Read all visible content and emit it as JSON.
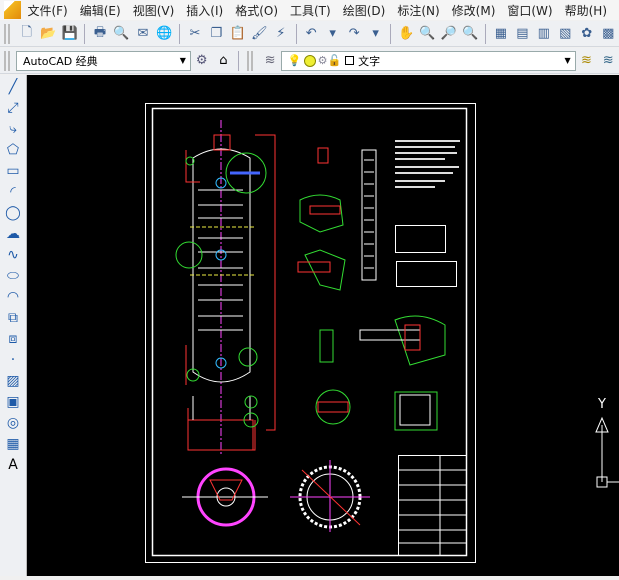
{
  "menu": [
    "文件(F)",
    "编辑(E)",
    "视图(V)",
    "插入(I)",
    "格式(O)",
    "工具(T)",
    "绘图(D)",
    "标注(N)",
    "修改(M)",
    "窗口(W)",
    "帮助(H)"
  ],
  "toolbar1": [
    {
      "icon": "new-icon",
      "g": "🗋"
    },
    {
      "icon": "open-icon",
      "g": "📂"
    },
    {
      "icon": "save-icon",
      "g": "💾"
    },
    "sep",
    {
      "icon": "print-icon",
      "g": "🖶"
    },
    {
      "icon": "print-preview-icon",
      "g": "🔍"
    },
    {
      "icon": "publish-icon",
      "g": "✉"
    },
    {
      "icon": "web-icon",
      "g": "🌐"
    },
    "sep",
    {
      "icon": "cut-icon",
      "g": "✂"
    },
    {
      "icon": "copy-icon",
      "g": "❐"
    },
    {
      "icon": "paste-icon",
      "g": "📋"
    },
    {
      "icon": "match-properties-icon",
      "g": "🖌"
    },
    {
      "icon": "block-editor-icon",
      "g": "⚡"
    },
    "sep",
    {
      "icon": "undo-icon",
      "g": "↶"
    },
    {
      "icon": "dropdown-icon",
      "g": "▾"
    },
    {
      "icon": "redo-icon",
      "g": "↷"
    },
    {
      "icon": "dropdown-icon",
      "g": "▾"
    },
    "sep",
    {
      "icon": "pan-icon",
      "g": "✋"
    },
    {
      "icon": "zoom-realtime-icon",
      "g": "🔍"
    },
    {
      "icon": "zoom-window-icon",
      "g": "🔎"
    },
    {
      "icon": "zoom-previous-icon",
      "g": "🔍"
    },
    "sep",
    {
      "icon": "properties-icon",
      "g": "▦"
    },
    {
      "icon": "design-center-icon",
      "g": "▤"
    },
    {
      "icon": "tool-palettes-icon",
      "g": "▥"
    },
    {
      "icon": "sheet-set-icon",
      "g": "▧"
    },
    {
      "icon": "markup-icon",
      "g": "✿"
    },
    {
      "icon": "calculator-icon",
      "g": "▩"
    }
  ],
  "workspace": {
    "value": "AutoCAD 经典"
  },
  "layer": {
    "value": "文字"
  },
  "left_tools": [
    {
      "icon": "line-icon",
      "g": "╱"
    },
    {
      "icon": "construction-line-icon",
      "g": "⤢"
    },
    {
      "icon": "polyline-icon",
      "g": "⤷"
    },
    {
      "icon": "polygon-icon",
      "g": "⬠"
    },
    {
      "icon": "rectangle-icon",
      "g": "▭"
    },
    {
      "icon": "arc-icon",
      "g": "◜"
    },
    {
      "icon": "circle-icon",
      "g": "◯"
    },
    {
      "icon": "revision-cloud-icon",
      "g": "☁"
    },
    {
      "icon": "spline-icon",
      "g": "∿"
    },
    {
      "icon": "ellipse-icon",
      "g": "⬭"
    },
    {
      "icon": "ellipse-arc-icon",
      "g": "◠"
    },
    {
      "icon": "insert-block-icon",
      "g": "⧉"
    },
    {
      "icon": "make-block-icon",
      "g": "⧈"
    },
    {
      "icon": "point-icon",
      "g": "·"
    },
    {
      "icon": "hatch-icon",
      "g": "▨"
    },
    {
      "icon": "gradient-icon",
      "g": "▣"
    },
    {
      "icon": "region-icon",
      "g": "◎"
    },
    {
      "icon": "table-icon",
      "g": "▦"
    },
    {
      "icon": "multiline-text-icon",
      "g": "A"
    }
  ],
  "ucs": {
    "axis_label": "Y"
  },
  "colors": {
    "background": "#000000",
    "white": "#ffffff",
    "red": "#ff2020",
    "green": "#30d030",
    "magenta": "#ff40ff",
    "blue": "#4060ff",
    "yellow": "#ffff40",
    "cyan": "#40c0ff"
  }
}
